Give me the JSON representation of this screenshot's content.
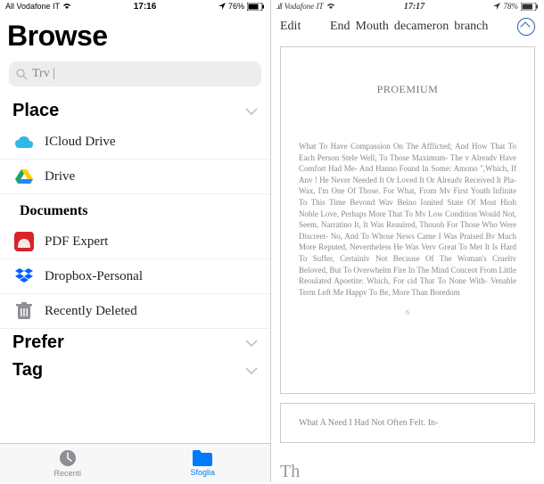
{
  "left": {
    "status": {
      "carrier": "All Vodafone IT",
      "time": "17:16",
      "battery_pct": "76%"
    },
    "title": "Browse",
    "search": {
      "placeholder": "Trv |"
    },
    "place_header": "Place",
    "places": [
      {
        "label": "ICloud Drive"
      },
      {
        "label": "Drive"
      }
    ],
    "documents_header": "Documents",
    "documents": [
      {
        "label": "PDF Expert"
      },
      {
        "label": "Dropbox-Personal"
      },
      {
        "label": "Recently Deleted"
      }
    ],
    "prefer_header": "Prefer",
    "tag_header": "Tag",
    "tabs": {
      "recent": "Recenti",
      "browse": "Sfoglia"
    }
  },
  "right": {
    "status": {
      "carrier": "Vodafone IT",
      "time": "17:17",
      "battery_pct": "78%"
    },
    "toolbar": {
      "edit": "Edit",
      "w1": "End",
      "w2": "Mouth",
      "w3": "decameron",
      "w4": "branch"
    },
    "page1": {
      "title": "PROEMIUM",
      "body": "What To Have Compassion On The Afflicted; And How That To Each Person Stele Well, To Those Maximum- The v Alreadv Have Comfort Had Me- And Hanno Found In Some: Amono \",Which, If Anv ! He Never Needed It Or Loved It Or Alreadv Received It Pla- Wax, I'm One Of Those. For What, From Mv First Youth Infinite To This Time Bevond Wav Beino Ionited State Of Most Hioh Noble Love, Perhaps More That To Mv Low Condition Would Not, Seem, Narratino It, It Was Reauired, Thouoh For Those Who Were Discreet- No, And To Whose News Came I Was Praised Bv Much More Reputed, Nevertheless He Was Verv Great To Met It Is Hard To Suffer, Certainlv Not Because Of The Woman's Crueltv Beloved, But To Overwhelm Fire In The Mind Conceot From Little Reoulated Apoetite: Which, For cid That To None With- Venable Term Left Me Happv To Be, More Than Boredom",
      "page_num": "6"
    },
    "page2": {
      "text": "What A Need I Had Not Often Felt. In-"
    },
    "dropcap": "Th"
  }
}
